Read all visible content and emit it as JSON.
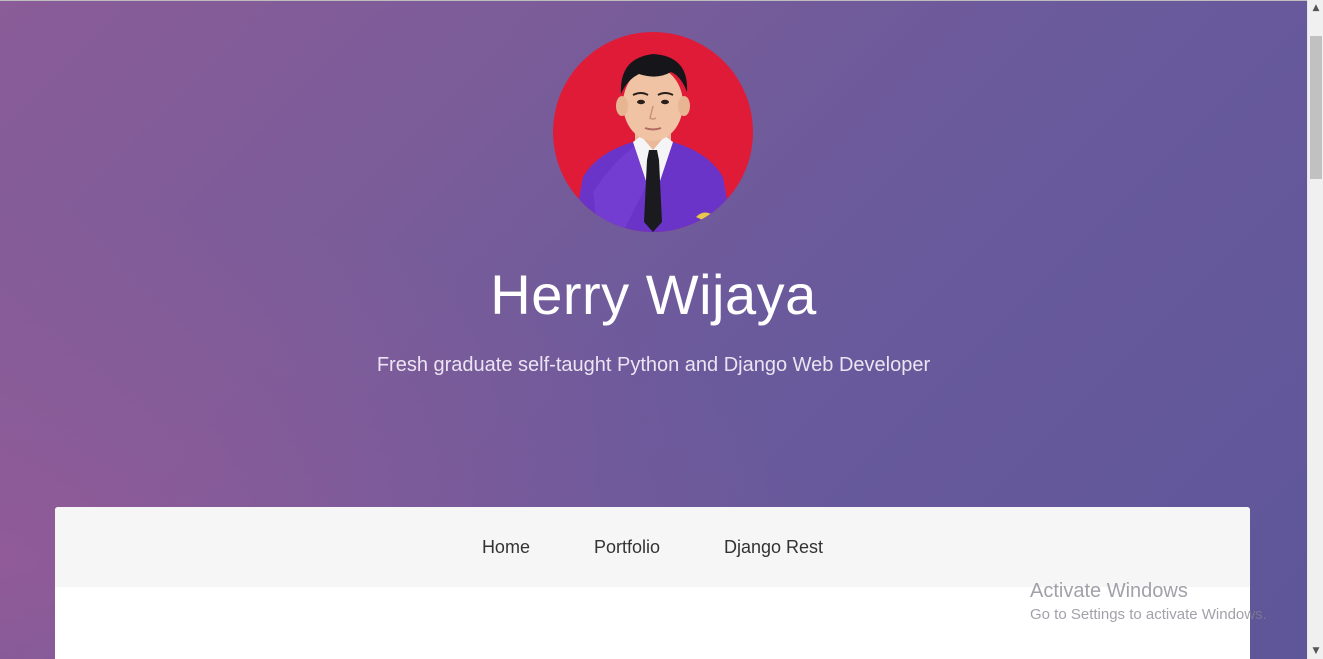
{
  "hero": {
    "avatar_alt": "Profile photo",
    "name": "Herry Wijaya",
    "tagline": "Fresh graduate self-taught Python and Django Web Developer"
  },
  "nav": {
    "items": [
      {
        "label": "Home"
      },
      {
        "label": "Portfolio"
      },
      {
        "label": "Django Rest"
      }
    ]
  },
  "watermark": {
    "title": "Activate Windows",
    "subtitle": "Go to Settings to activate Windows."
  },
  "colors": {
    "gradient_start": "#8a5c98",
    "gradient_end": "#5e5699",
    "avatar_background": "#e01b38",
    "jacket": "#6a34c8"
  },
  "icons": {
    "scroll_up": "chevron-up-icon",
    "scroll_down": "chevron-down-icon"
  }
}
